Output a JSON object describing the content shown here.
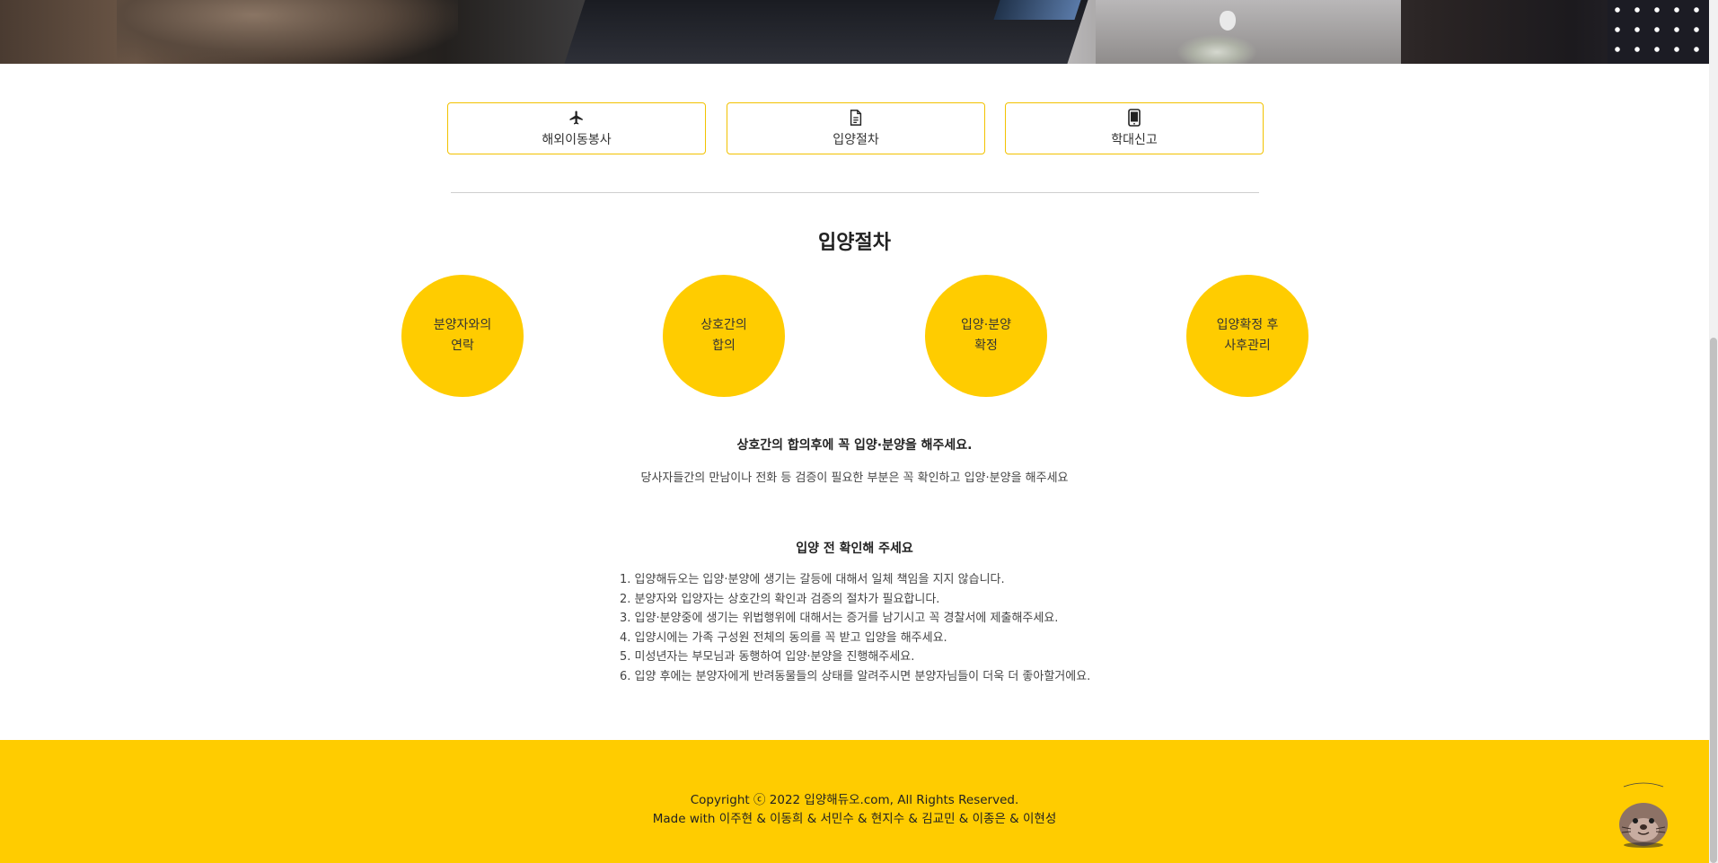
{
  "services": [
    {
      "label": "해외이동봉사",
      "icon": "airplane-icon"
    },
    {
      "label": "입양절차",
      "icon": "document-icon"
    },
    {
      "label": "학대신고",
      "icon": "mobile-phone-icon"
    }
  ],
  "section_title": "입양절차",
  "steps": [
    {
      "line1": "분양자와의",
      "line2": "연락"
    },
    {
      "line1": "상호간의",
      "line2": "합의"
    },
    {
      "line1": "입양·분양",
      "line2": "확정"
    },
    {
      "line1": "입양확정 후",
      "line2": "사후관리"
    }
  ],
  "notice": {
    "title": "상호간의 합의후에 꼭 입양·분양을 해주세요.",
    "subtitle": "당사자들간의 만남이나 전화 등 검증이 필요한 부분은 꼭 확인하고 입양·분양을 해주세요"
  },
  "checklist": {
    "title": "입양 전 확인해 주세요",
    "items": [
      "1. 입양해듀오는 입양·분양에 생기는 갈등에 대해서 일체 책임을 지지 않습니다.",
      "2. 분양자와 입양자는 상호간의 확인과 검증의 절차가 필요합니다.",
      "3. 입양·분양중에 생기는 위법행위에 대해서는 증거를 남기시고 꼭 경찰서에 제출해주세요.",
      "4. 입양시에는 가족 구성원 전체의 동의를 꼭 받고 입양을 해주세요.",
      "5. 미성년자는 부모님과 동행하여 입양·분양을 진행해주세요.",
      "6. 입양 후에는 분양자에게 반려동물들의 상태를 알려주시면 분양자님들이 더욱 더 좋아할거에요."
    ]
  },
  "footer": {
    "copyright": "Copyright ⓒ 2022 입양해듀오.com, All Rights Reserved.",
    "credits": "Made with 이주현 & 이동희 & 서민수 & 현지수 & 김교민 & 이종은 & 이현성"
  },
  "colors": {
    "accent": "#ffcc00",
    "button_border": "#f2c200"
  }
}
